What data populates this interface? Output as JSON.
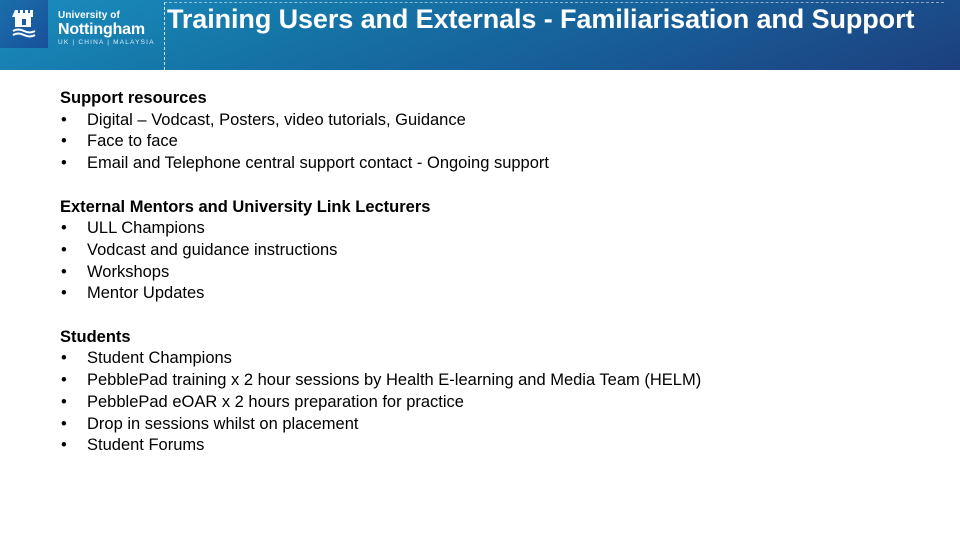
{
  "header": {
    "logo": {
      "icon": "castle-crest-icon",
      "line1": "University of",
      "line2": "Nottingham",
      "line3": "UK | CHINA | MALAYSIA"
    },
    "title": "Training Users and Externals - Familiarisation and Support",
    "colors": {
      "gradient_start": "#1b8cbf",
      "gradient_end": "#1d3f7e"
    }
  },
  "sections": [
    {
      "heading": "Support resources",
      "items": [
        "Digital – Vodcast, Posters, video tutorials, Guidance",
        "Face to face",
        "Email and Telephone central support contact - Ongoing support"
      ]
    },
    {
      "heading": "External Mentors and University Link Lecturers",
      "items": [
        "ULL Champions",
        "Vodcast and guidance instructions",
        "Workshops",
        "Mentor Updates"
      ]
    },
    {
      "heading": "Students",
      "items": [
        "Student Champions",
        "PebblePad training x 2 hour sessions by Health E-learning and Media Team (HELM)",
        "PebblePad eOAR x 2 hours preparation for practice",
        "Drop in sessions whilst on placement",
        "Student Forums"
      ]
    }
  ],
  "bullet_glyph": "•"
}
